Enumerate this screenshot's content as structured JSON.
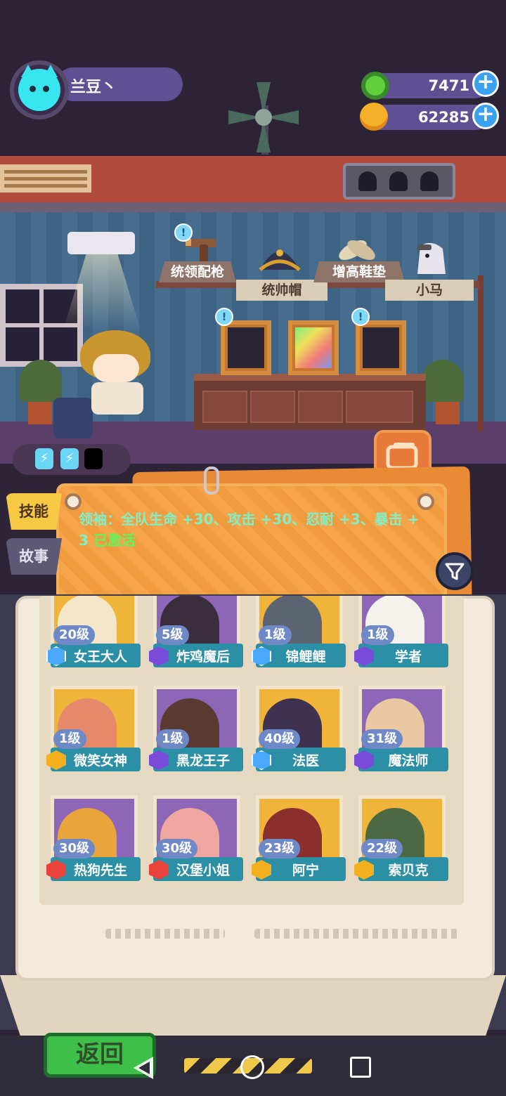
{
  "player": {
    "name": "兰豆丶",
    "avatar_icon": "cat-face-icon",
    "avatar_color": "#38e6f0"
  },
  "resources": [
    {
      "name": "donut-currency",
      "icon": "donut-icon",
      "value": "7471"
    },
    {
      "name": "planet-coin",
      "icon": "planet-coin-icon",
      "value": "62285"
    }
  ],
  "plus_label": "+",
  "items": [
    {
      "label": "统领配枪",
      "icon": "pistol-icon"
    },
    {
      "label": "统帅帽",
      "icon": "bicorne-hat-icon"
    },
    {
      "label": "增高鞋垫",
      "icon": "insole-icon"
    },
    {
      "label": "小马",
      "icon": "pony-icon"
    }
  ],
  "hints": [
    "!",
    "!",
    "!"
  ],
  "energy": [
    "⚡",
    "⚡"
  ],
  "tabs": {
    "skill": "技能",
    "story": "故事"
  },
  "skill": {
    "text": "领袖：全队生命 +30、攻击 +30、忍耐 +3、暴击 + 3",
    "status": "已激活"
  },
  "characters": [
    {
      "name": "女王大人",
      "level": "20级",
      "rarity": "blue"
    },
    {
      "name": "炸鸡魔后",
      "level": "5级",
      "rarity": "violet"
    },
    {
      "name": "锦鲤鲤",
      "level": "1级",
      "rarity": "blue"
    },
    {
      "name": "学者",
      "level": "1级",
      "rarity": "violet"
    },
    {
      "name": "微笑女神",
      "level": "1级",
      "rarity": "gold"
    },
    {
      "name": "黑龙王子",
      "level": "1级",
      "rarity": "violet"
    },
    {
      "name": "法医",
      "level": "40级",
      "rarity": "blue"
    },
    {
      "name": "魔法师",
      "level": "31级",
      "rarity": "violet"
    },
    {
      "name": "热狗先生",
      "level": "30级",
      "rarity": "red"
    },
    {
      "name": "汉堡小姐",
      "level": "30级",
      "rarity": "red"
    },
    {
      "name": "阿宁",
      "level": "23级",
      "rarity": "gold"
    },
    {
      "name": "索贝克",
      "level": "22级",
      "rarity": "gold"
    }
  ],
  "back_button": "返回",
  "colors": {
    "accent": "#f59e3e",
    "panel": "#5f4f93",
    "active_text": "#5ef55e"
  }
}
